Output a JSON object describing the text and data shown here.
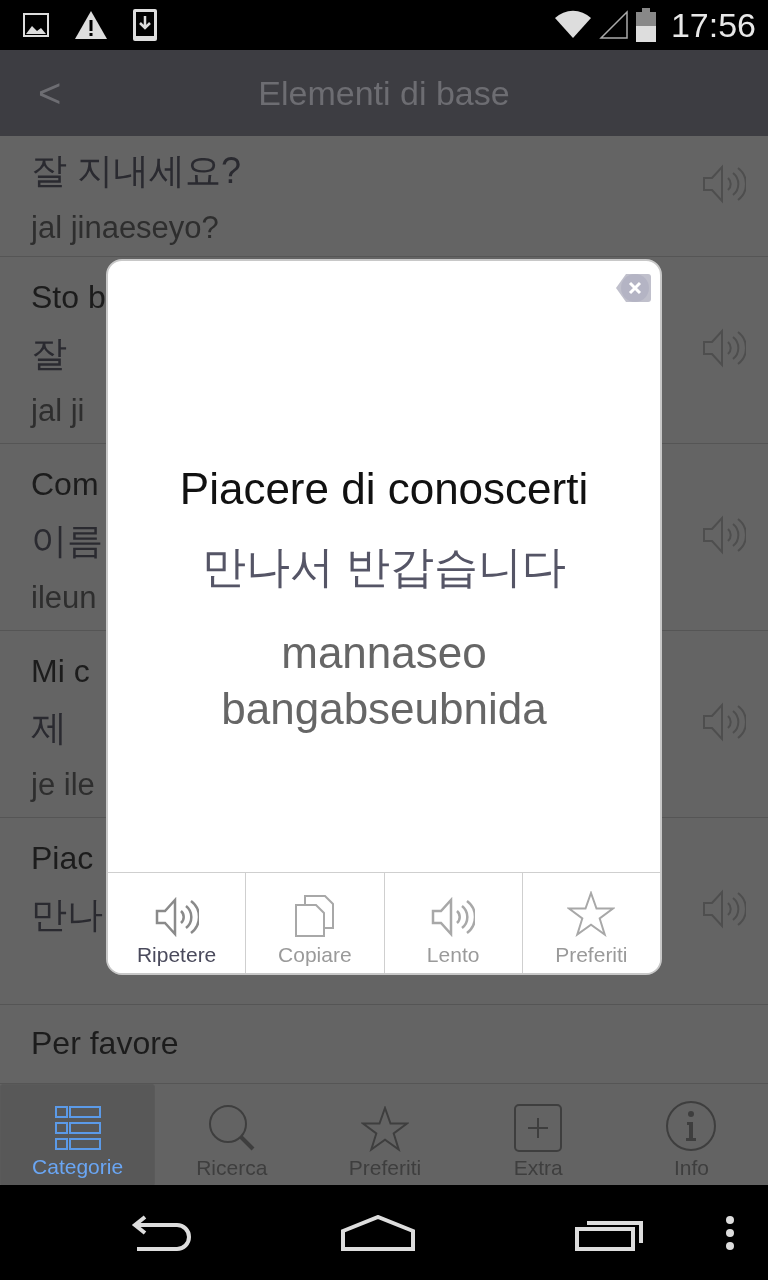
{
  "status_bar": {
    "time": "17:56"
  },
  "header": {
    "back": "<",
    "title": "Elementi di base"
  },
  "phrases": [
    {
      "speaker": true,
      "lines": [
        {
          "kind": "korean",
          "text": "잘 지내세요?"
        },
        {
          "kind": "roman",
          "text": "jal jinaeseyo?"
        }
      ]
    },
    {
      "speaker": true,
      "lines": [
        {
          "kind": "italian",
          "text": "Sto b"
        },
        {
          "kind": "korean",
          "text": "잘"
        },
        {
          "kind": "roman",
          "text": "jal ji"
        }
      ]
    },
    {
      "speaker": true,
      "lines": [
        {
          "kind": "italian",
          "text": "Com"
        },
        {
          "kind": "korean",
          "text": "이름"
        },
        {
          "kind": "roman",
          "text": "ileun"
        }
      ]
    },
    {
      "speaker": true,
      "lines": [
        {
          "kind": "italian",
          "text": "Mi c"
        },
        {
          "kind": "korean",
          "text": "제"
        },
        {
          "kind": "roman",
          "text": "je ile"
        }
      ]
    },
    {
      "speaker": true,
      "lines": [
        {
          "kind": "italian",
          "text": "Piac"
        },
        {
          "kind": "korean",
          "text": "만나"
        }
      ]
    },
    {
      "speaker": false,
      "lines": [
        {
          "kind": "italian",
          "text": "Per favore"
        }
      ]
    }
  ],
  "dialog": {
    "italian": "Piacere di conoscerti",
    "korean": "만나서 반갑습니다",
    "roman": "mannaseo bangabseubnida",
    "actions": [
      {
        "kind": "speaker",
        "label": "Ripetere",
        "disabled": false
      },
      {
        "kind": "copy",
        "label": "Copiare",
        "disabled": true
      },
      {
        "kind": "speaker",
        "label": "Lento",
        "disabled": true
      },
      {
        "kind": "star",
        "label": "Preferiti",
        "disabled": true
      }
    ]
  },
  "tabs": [
    {
      "kind": "categories",
      "label": "Categorie",
      "selected": true
    },
    {
      "kind": "search",
      "label": "Ricerca",
      "selected": false
    },
    {
      "kind": "star",
      "label": "Preferiti",
      "selected": false
    },
    {
      "kind": "plus",
      "label": "Extra",
      "selected": false
    },
    {
      "kind": "info",
      "label": "Info",
      "selected": false
    }
  ]
}
